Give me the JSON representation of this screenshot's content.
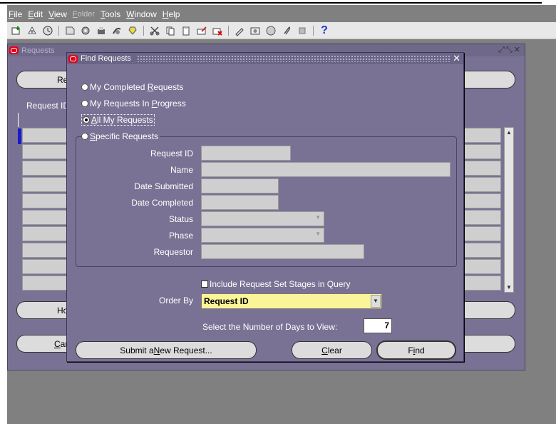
{
  "menubar": {
    "items": [
      {
        "label": "File",
        "key": "F",
        "rest": "ile"
      },
      {
        "label": "Edit",
        "key": "E",
        "rest": "dit"
      },
      {
        "label": "View",
        "key": "V",
        "rest": "iew"
      },
      {
        "label": "Folder",
        "key": "F",
        "rest": "older"
      },
      {
        "label": "Tools",
        "key": "T",
        "rest": "ools"
      },
      {
        "label": "Window",
        "key": "W",
        "rest": "indow"
      },
      {
        "label": "Help",
        "key": "H",
        "rest": "elp"
      }
    ]
  },
  "toolbar": {
    "icons": [
      "new-record-icon",
      "navigator-icon",
      "zoom-icon",
      "save-icon",
      "print-icon",
      "close-form-icon",
      "cut-icon",
      "copy-icon",
      "paste-icon",
      "clear-record-icon",
      "delete-record-icon",
      "edit-field-icon",
      "folder-icon",
      "translations-icon",
      "attachments-icon",
      "folder-tools-icon"
    ],
    "help_glyph": "?"
  },
  "requests_window": {
    "title": "Requests",
    "controls": "⤢⤡✕",
    "refresh_label": "Re",
    "column_header": "Request ID",
    "hold_label": "Ho",
    "cancel_label_key": "C",
    "cancel_label_rest": "ar"
  },
  "find_dialog": {
    "title": "Find Requests",
    "close": "✕",
    "options": {
      "completed": {
        "pre": "My Completed ",
        "key": "R",
        "post": "equests"
      },
      "in_progress": {
        "pre": "My Requests In ",
        "key": "P",
        "post": "rogress"
      },
      "all": {
        "pre": "",
        "key": "A",
        "post": "ll My Requests"
      },
      "specific": {
        "pre": "",
        "key": "S",
        "post": "pecific Requests"
      }
    },
    "selected_option": "all",
    "fields": {
      "request_id": {
        "label": "Request ID",
        "value": ""
      },
      "name": {
        "label": "Name",
        "value": ""
      },
      "date_submitted": {
        "label": "Date Submitted",
        "value": ""
      },
      "date_completed": {
        "label": "Date Completed",
        "value": ""
      },
      "status": {
        "label": "Status",
        "value": ""
      },
      "phase": {
        "label": "Phase",
        "value": ""
      },
      "requestor": {
        "label": "Requestor",
        "value": ""
      }
    },
    "include_stages": {
      "label": "Include Request Set Stages in Query",
      "checked": false
    },
    "order_by": {
      "label": "Order By",
      "value": "Request ID"
    },
    "days": {
      "label": "Select the Number of Days to View:",
      "value": "7"
    },
    "buttons": {
      "submit_new": {
        "pre": "Submit a ",
        "key": "N",
        "post": "ew Request..."
      },
      "clear": {
        "pre": "",
        "key": "C",
        "post": "lear"
      },
      "find": {
        "pre": "F",
        "key": "i",
        "post": "nd"
      }
    }
  }
}
